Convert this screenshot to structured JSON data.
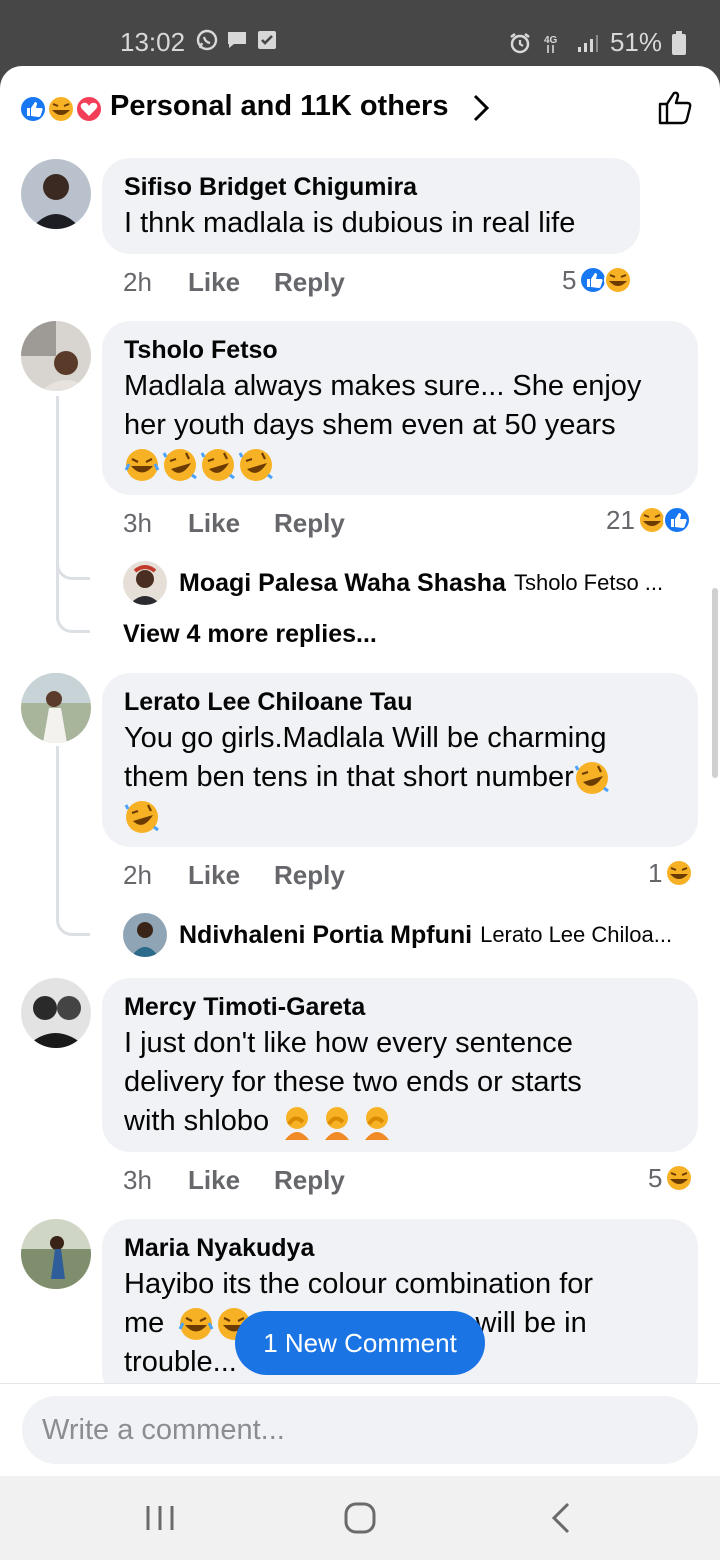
{
  "status_bar": {
    "time": "13:02",
    "battery": "51%",
    "network": "4G"
  },
  "header": {
    "reactions_summary": "Personal and 11K others"
  },
  "comments": [
    {
      "name": "Sifiso Bridget Chigumira",
      "text": "I thnk madlala is dubious in real life",
      "time": "2h",
      "like": "Like",
      "reply": "Reply",
      "reaction_count": "5"
    },
    {
      "name": "Tsholo Fetso",
      "text_lines": [
        "Madlala always makes sure... She enjoy",
        "her youth days shem even at 50 years"
      ],
      "time": "3h",
      "like": "Like",
      "reply": "Reply",
      "reaction_count": "21",
      "reply_preview": {
        "name": "Moagi Palesa Waha Shasha",
        "text": "Tsholo Fetso ..."
      },
      "view_more": "View 4 more replies..."
    },
    {
      "name": "Lerato Lee Chiloane Tau",
      "text_lines": [
        "You go girls.Madlala Will be charming",
        "them ben tens in that short number"
      ],
      "time": "2h",
      "like": "Like",
      "reply": "Reply",
      "reaction_count": "1",
      "reply_preview": {
        "name": "Ndivhaleni Portia Mpfuni",
        "text": "Lerato Lee Chiloa..."
      }
    },
    {
      "name": "Mercy Timoti-Gareta",
      "text_lines": [
        "I just don't like how every sentence",
        "delivery for these two ends or starts",
        "with shlobo"
      ],
      "time": "3h",
      "like": "Like",
      "reply": "Reply",
      "reaction_count": "5"
    },
    {
      "name": "Maria Nyakudya",
      "text_lines": [
        "Hayibo its the colour combination for",
        "me",
        "sts will be in",
        "trouble..."
      ]
    }
  ],
  "new_comment_pill": "1 New Comment",
  "composer": {
    "placeholder": "Write a comment..."
  },
  "colors": {
    "brand_blue": "#1b74e4",
    "bubble_bg": "#f0f2f5",
    "like_blue": "#1877f2",
    "haha_yellow": "#f7b125",
    "love_red": "#f33e58"
  }
}
